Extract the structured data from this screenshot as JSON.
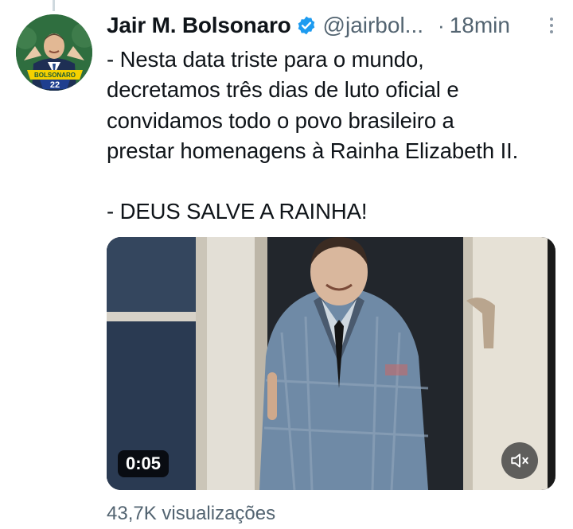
{
  "tweet": {
    "author_name": "Jair M. Bolsonaro",
    "handle": "@jairbol...",
    "separator": "·",
    "time": "18min",
    "text": "- Nesta data triste para o mundo,\ndecretamos três dias de luto oficial e\nconvidamos todo o povo brasileiro a\nprestar homenagens à Rainha Elizabeth II.\n\n- DEUS SALVE A RAINHA!",
    "avatar_text": "BOLSONARO",
    "avatar_number": "22",
    "media": {
      "duration": "0:05",
      "mute_icon": "volume-muted-icon"
    },
    "views": "43,7K visualizações"
  },
  "colors": {
    "verified": "#1d9bf0",
    "muted_text": "#536471",
    "avatar_green": "#2c6d3e",
    "avatar_yellow": "#f5d100"
  }
}
